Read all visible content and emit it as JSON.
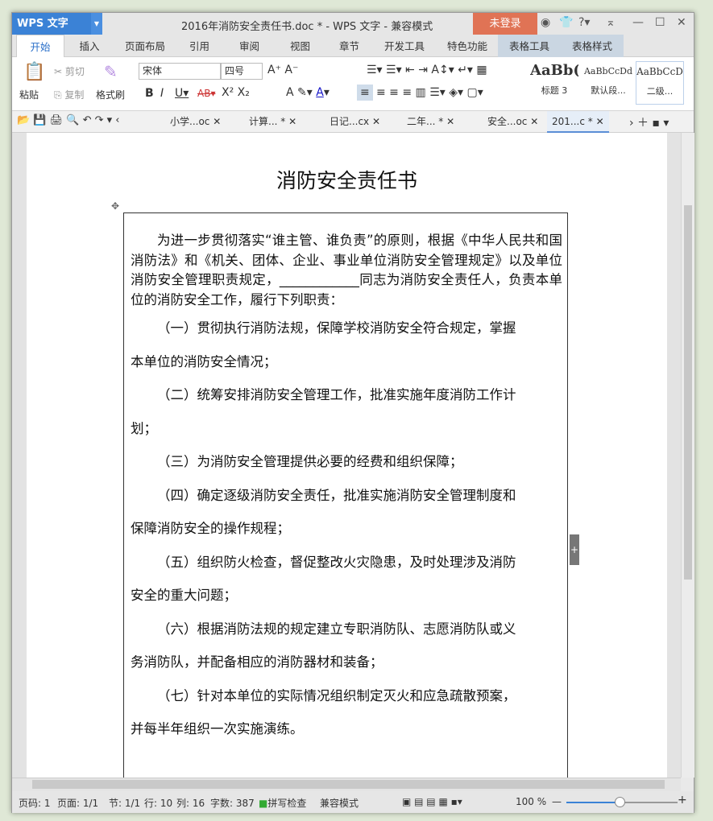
{
  "app": {
    "name": "WPS 文字",
    "title": "2016年消防安全责任书.doc * - WPS 文字 - 兼容模式",
    "login": "未登录"
  },
  "menu": [
    "开始",
    "插入",
    "页面布局",
    "引用",
    "审阅",
    "视图",
    "章节",
    "开发工具",
    "特色功能",
    "表格工具",
    "表格样式"
  ],
  "ribbon": {
    "paste": "粘贴",
    "cut": "剪切",
    "copy": "复制",
    "format_painter": "格式刷",
    "font": "宋体",
    "size": "四号",
    "styles": [
      {
        "preview": "AaBb(",
        "label": "标题 3"
      },
      {
        "preview": "AaBbCcDd",
        "label": "默认段..."
      },
      {
        "preview": "AaBbCcD",
        "label": "二级..."
      }
    ]
  },
  "doc_tabs": [
    "小学...oc",
    "计算... *",
    "日记...cx",
    "二年... *",
    "安全...oc",
    "201...c *"
  ],
  "document": {
    "title": "消防安全责任书",
    "intro": "为进一步贯彻落实“谁主管、谁负责”的原则，根据《中华人民共和国消防法》和《机关、团体、企业、事业单位消防安全管理规定》以及单位消防安全管理职责规定，",
    "intro_blank": "____________",
    "intro_end": "同志为消防安全责任人，负责本单位的消防安全工作，履行下列职责：",
    "items": [
      [
        "（一）贯彻执行消防法规，保障学校消防安全符合规定，掌握",
        "本单位的消防安全情况；"
      ],
      [
        "（二）统筹安排消防安全管理工作，批准实施年度消防工作计",
        "划；"
      ],
      [
        "（三）为消防安全管理提供必要的经费和组织保障；"
      ],
      [
        "（四）确定逐级消防安全责任，批准实施消防安全管理制度和",
        "保障消防安全的操作规程；"
      ],
      [
        "（五）组织防火检查，督促整改火灾隐患，及时处理涉及消防",
        "安全的重大问题；"
      ],
      [
        "（六）根据消防法规的规定建立专职消防队、志愿消防队或义",
        "务消防队，并配备相应的消防器材和装备；"
      ],
      [
        "（七）针对本单位的实际情况组织制定灭火和应急疏散预案，",
        "并每半年组织一次实施演练。"
      ]
    ]
  },
  "status": {
    "page_no": "页码: 1",
    "pages": "页面: 1/1",
    "section": "节: 1/1",
    "row": "行: 10",
    "col": "列: 16",
    "words": "字数: 387",
    "spell": "拼写检查",
    "mode": "兼容模式",
    "zoom": "100 %",
    "zoom_value": 100
  },
  "colors": {
    "accent": "#3b82d6",
    "login": "#e07355"
  }
}
